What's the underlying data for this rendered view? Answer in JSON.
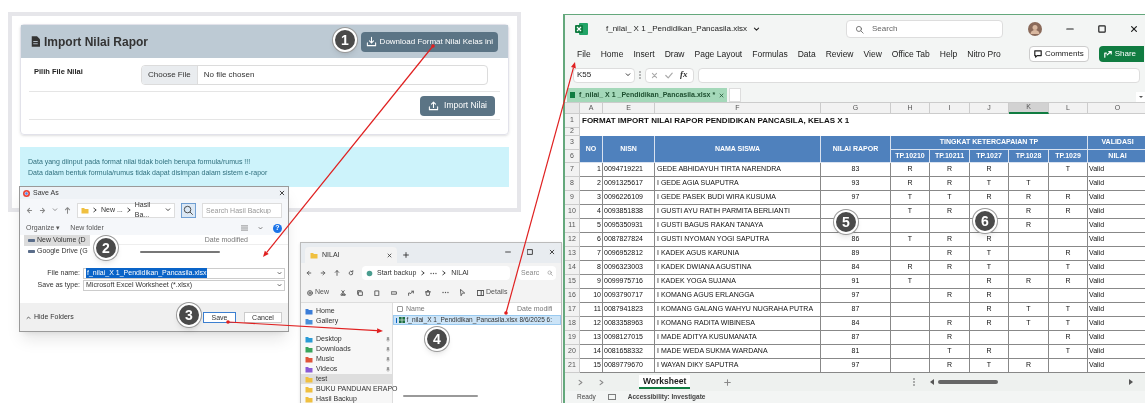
{
  "web_panel": {
    "title": "Import Nilai Rapor",
    "download_button": "Download Format Nilai Kelas ini",
    "file_label": "Pilih File Nilai",
    "choose_button": "Choose File",
    "file_status": "No file chosen",
    "import_button": "Import Nilai",
    "notice_lines": [
      "Data yang diinput pada format nilai tidak boleh berupa formula/rumus !!!",
      "Data dalam bentuk formula/rumus tidak dapat disimpan dalam sistem e-rapor"
    ]
  },
  "save_dialog": {
    "title": "Save As",
    "path": [
      "New ...",
      "Hasil Ba..."
    ],
    "search_placeholder": "Search Hasil Backup",
    "organize": "Organize ▾",
    "new_folder": "New folder",
    "help": "?",
    "nav_items": [
      {
        "label": "New Volume (D",
        "selected": true
      },
      {
        "label": "Google Drive (G",
        "selected": false
      }
    ],
    "column_header": "Date modified",
    "file_name_label": "File name:",
    "file_name": "f_nilai_X 1_Pendidikan_Pancasila.xlsx",
    "type_label": "Save as type:",
    "type_value": "Microsoft Excel Worksheet (*.xlsx)",
    "hide_folders": "Hide Folders",
    "save_button": "Save",
    "cancel_button": "Cancel"
  },
  "explorer": {
    "tab": "NILAI",
    "path": [
      "Start backup",
      "NILAI"
    ],
    "search_placeholder": "Searc",
    "new_button": "New",
    "details_button": "Details",
    "nav_items": [
      {
        "label": "Home",
        "pinned": false,
        "selected": false
      },
      {
        "label": "Gallery",
        "pinned": false,
        "selected": false
      },
      {
        "label": "Desktop",
        "pinned": true,
        "selected": false
      },
      {
        "label": "Downloads",
        "pinned": true,
        "selected": false
      },
      {
        "label": "Music",
        "pinned": true,
        "selected": false
      },
      {
        "label": "Videos",
        "pinned": true,
        "selected": false
      },
      {
        "label": "test",
        "pinned": false,
        "selected": true
      },
      {
        "label": "BUKU PANDUAN ERAPO",
        "pinned": false,
        "selected": false
      },
      {
        "label": "Hasil Backup",
        "pinned": false,
        "selected": false
      }
    ],
    "all_selected": false,
    "column_name": "Name",
    "column_date": "Date modifi",
    "files": [
      {
        "name": "f_nilai_X 1_Pendidikan_Pancasila.xlsx",
        "date": "8/6/2025 6:",
        "selected": true
      }
    ]
  },
  "excel": {
    "file_title": "f_nilai_ X 1 _Pendidikan_Pancasila.xlsx",
    "search_placeholder": "Search",
    "menu": [
      "File",
      "Home",
      "Insert",
      "Draw",
      "Page Layout",
      "Formulas",
      "Data",
      "Review",
      "View",
      "Office Tab",
      "Help",
      "Nitro Pro"
    ],
    "comments_button": "Comments",
    "share_button": "Share",
    "name_box": "K55",
    "function_label": "fx",
    "doc_tab": "f_nilai_ X 1 _Pendidikan_Pancasila.xlsx *",
    "sheet": {
      "columns": [
        {
          "label": "A",
          "selected": false
        },
        {
          "label": "E",
          "selected": false
        },
        {
          "label": "F",
          "selected": false
        },
        {
          "label": "G",
          "selected": false
        },
        {
          "label": "H",
          "selected": false
        },
        {
          "label": "I",
          "selected": false
        },
        {
          "label": "J",
          "selected": false
        },
        {
          "label": "K",
          "selected": true
        },
        {
          "label": "L",
          "selected": false
        },
        {
          "label": "O",
          "selected": false
        }
      ],
      "title_row": {
        "row_number": "1",
        "text": "FORMAT IMPORT NILAI RAPOR PENDIDIKAN PANCASILA, KELAS  X 1"
      },
      "blank_row": {
        "row_number": "2"
      },
      "header_row_numbers": [
        "3",
        "6"
      ],
      "headers": {
        "no": "NO",
        "nisn": "NISN",
        "name": "NAMA SISWA",
        "score": "NILAI RAPOR",
        "tp_group": "TINGKAT KETERCAPAIAN TP",
        "tp_codes": [
          "TP.10210",
          "TP.10211",
          "TP.1027",
          "TP.1028",
          "TP.1029"
        ],
        "validation_group": "VALIDASI",
        "validation": "NILAI"
      },
      "rows": [
        {
          "row_number": "7",
          "no": "1",
          "nisn": "0094719221",
          "name": "GEDE ABHIDAYUH TIRTA NARENDRA",
          "score": "83",
          "tp": {
            "H": "R",
            "I": "R",
            "J": "R",
            "L": "T"
          },
          "validation": "Valid"
        },
        {
          "row_number": "8",
          "no": "2",
          "nisn": "0091325617",
          "name": "I GEDE AGIA SUAPUTRA",
          "score": "93",
          "tp": {
            "H": "R",
            "I": "R",
            "J": "T",
            "K": "T"
          },
          "validation": "Valid"
        },
        {
          "row_number": "9",
          "no": "3",
          "nisn": "0096226109",
          "name": "I GEDE PASEK BUDI WIRA KUSUMA",
          "score": "97",
          "tp": {
            "H": "T",
            "I": "T",
            "J": "R",
            "K": "R",
            "L": "R"
          },
          "validation": "Valid"
        },
        {
          "row_number": "10",
          "no": "4",
          "nisn": "0093851838",
          "name": "I GUSTI AYU RATIH PARMITA BERLIANTI",
          "tp": {
            "H": "T",
            "I": "R",
            "K": "R",
            "L": "R"
          },
          "validation": "Valid"
        },
        {
          "row_number": "11",
          "no": "5",
          "nisn": "0095350931",
          "name": "I GUSTI BAGUS RAKAN TANAYA",
          "tp": {
            "K": "R"
          },
          "validation": "Valid"
        },
        {
          "row_number": "12",
          "no": "6",
          "nisn": "0087827824",
          "name": "I GUSTI NYOMAN YOGI SAPUTRA",
          "score": "86",
          "tp": {
            "H": "T",
            "I": "R",
            "J": "R"
          },
          "validation": "Valid"
        },
        {
          "row_number": "13",
          "no": "7",
          "nisn": "0096952812",
          "name": "I KADEK AGUS KARUNIA",
          "score": "89",
          "tp": {
            "I": "R",
            "J": "T",
            "L": "R"
          },
          "validation": "Valid"
        },
        {
          "row_number": "14",
          "no": "8",
          "nisn": "0096323003",
          "name": "I KADEK DWIANA AGUSTINA",
          "score": "84",
          "tp": {
            "H": "R",
            "I": "R",
            "J": "T",
            "L": "T"
          },
          "validation": "Valid"
        },
        {
          "row_number": "15",
          "no": "9",
          "nisn": "0099975716",
          "name": "I KADEK YOGA SUJANA",
          "score": "91",
          "tp": {
            "H": "T",
            "J": "R",
            "K": "R",
            "L": "R"
          },
          "validation": "Valid"
        },
        {
          "row_number": "16",
          "no": "10",
          "nisn": "0093790717",
          "name": "I KOMANG AGUS ERLANGGA",
          "score": "97",
          "tp": {
            "I": "R",
            "J": "R"
          },
          "validation": "Valid"
        },
        {
          "row_number": "17",
          "no": "11",
          "nisn": "0087941823",
          "name": "I KOMANG GALANG WAHYU NUGRAHA PUTRA",
          "score": "87",
          "tp": {
            "J": "R",
            "K": "T",
            "L": "T"
          },
          "validation": "Valid"
        },
        {
          "row_number": "18",
          "no": "12",
          "nisn": "0083358963",
          "name": "I KOMANG RADITA WIBINESA",
          "score": "84",
          "tp": {
            "I": "R",
            "J": "R",
            "K": "T",
            "L": "T"
          },
          "validation": "Valid"
        },
        {
          "row_number": "19",
          "no": "13",
          "nisn": "0098127015",
          "name": "I MADE ADITYA KUSUMANATA",
          "score": "87",
          "tp": {
            "I": "R",
            "L": "R"
          },
          "validation": "Valid"
        },
        {
          "row_number": "20",
          "no": "14",
          "nisn": "0081658332",
          "name": "I MADE WEDA SUKMA WARDANA",
          "score": "81",
          "tp": {
            "I": "T",
            "J": "R",
            "L": "T"
          },
          "validation": "Valid"
        },
        {
          "row_number": "21",
          "no": "15",
          "nisn": "0089779670",
          "name": "I WAYAN DIKY SAPUTRA",
          "score": "97",
          "tp": {
            "I": "R",
            "J": "T",
            "K": "R"
          },
          "validation": "Valid"
        }
      ]
    },
    "sheet_tabs": [
      {
        "label": "Worksheet",
        "selected": true
      }
    ],
    "status": {
      "ready": "Ready",
      "accessibility": "Accessibility: Investigate"
    }
  },
  "steps": [
    "1",
    "2",
    "3",
    "4",
    "5",
    "6"
  ]
}
